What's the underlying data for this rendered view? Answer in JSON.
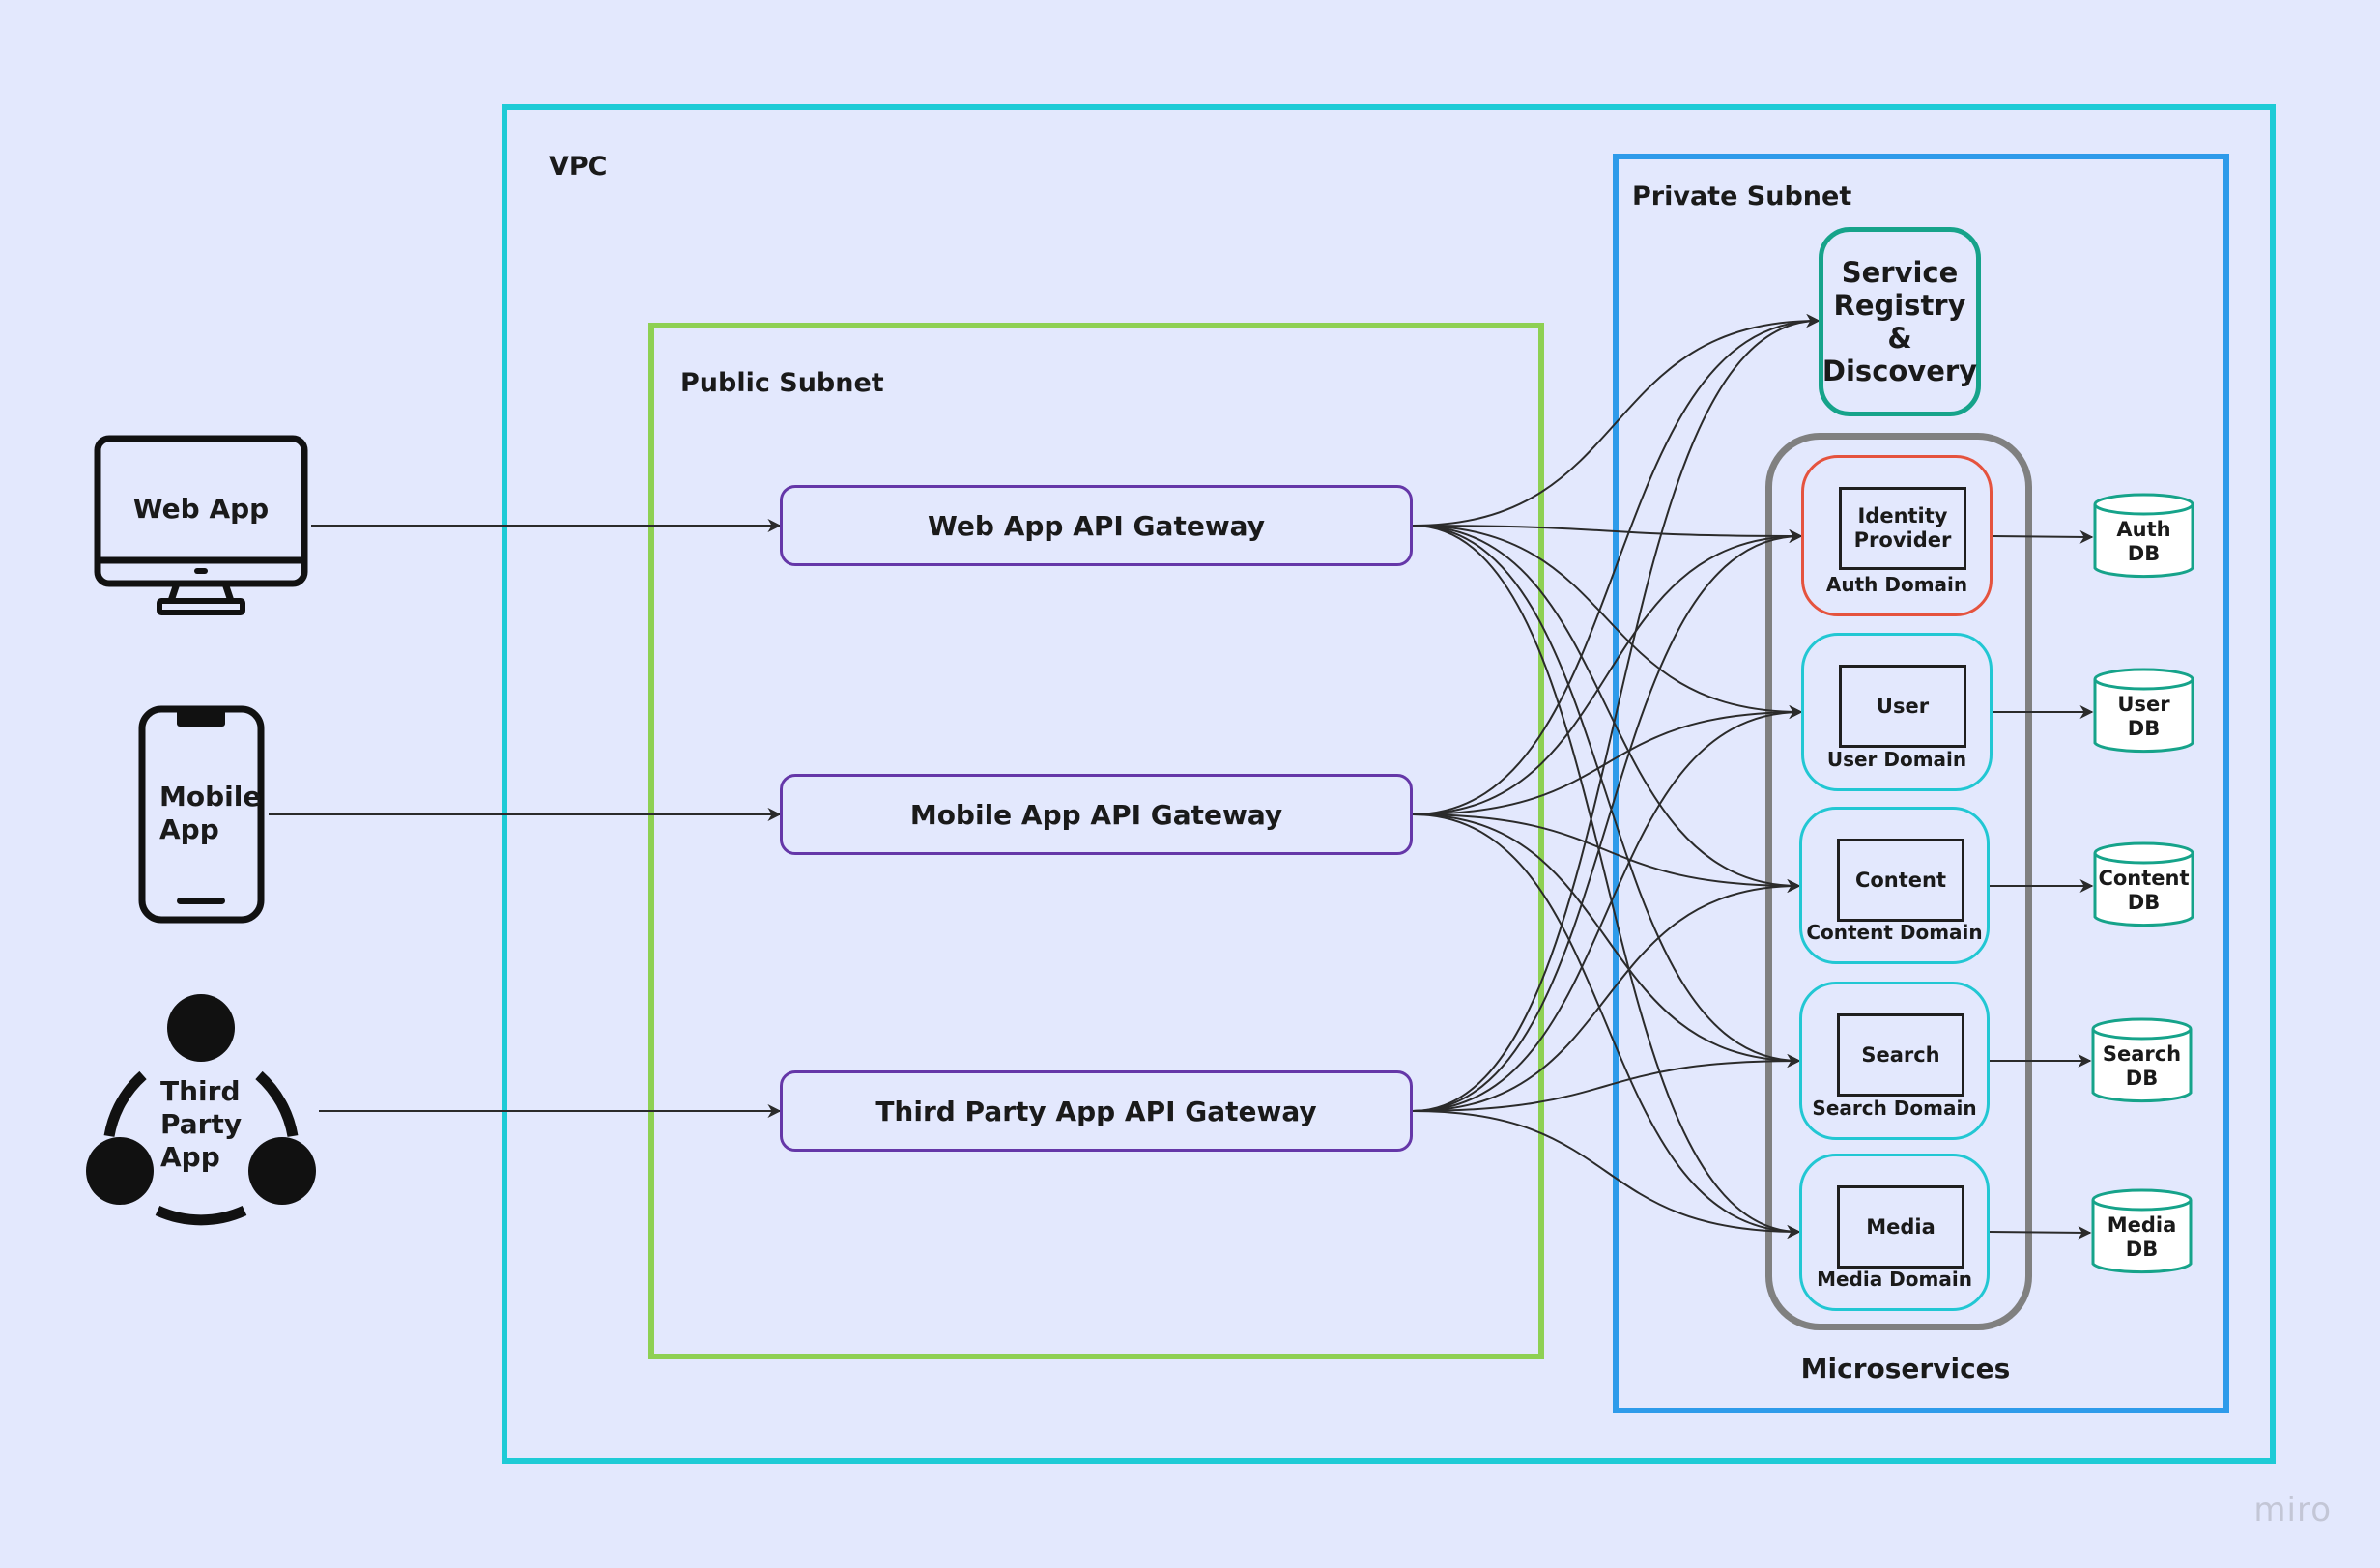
{
  "zones": {
    "vpc": "VPC",
    "public_subnet": "Public Subnet",
    "private_subnet": "Private Subnet",
    "microservices": "Microservices"
  },
  "clients": [
    {
      "id": "web",
      "label": "Web App",
      "icon": "desktop-monitor-icon"
    },
    {
      "id": "mobile",
      "label": "Mobile App",
      "icon": "smartphone-icon"
    },
    {
      "id": "third",
      "label": "Third Party App",
      "icon": "network-nodes-icon"
    }
  ],
  "gateways": [
    {
      "id": "web",
      "label": "Web App API Gateway"
    },
    {
      "id": "mobile",
      "label": "Mobile App API Gateway"
    },
    {
      "id": "third",
      "label": "Third Party App API Gateway"
    }
  ],
  "registry": {
    "label": "Service Registry & Discovery"
  },
  "domains": [
    {
      "id": "auth",
      "service": "Identity Provider",
      "domain": "Auth Domain",
      "db": "Auth DB",
      "accent": "#E5533E"
    },
    {
      "id": "user",
      "service": "User",
      "domain": "User Domain",
      "db": "User DB",
      "accent": "#22C7D3"
    },
    {
      "id": "content",
      "service": "Content",
      "domain": "Content Domain",
      "db": "Content DB",
      "accent": "#22C7D3"
    },
    {
      "id": "search",
      "service": "Search",
      "domain": "Search Domain",
      "db": "Search DB",
      "accent": "#22C7D3"
    },
    {
      "id": "media",
      "service": "Media",
      "domain": "Media Domain",
      "db": "Media DB",
      "accent": "#22C7D3"
    }
  ],
  "connections": {
    "client_to_gateway": [
      [
        "web",
        "web"
      ],
      [
        "mobile",
        "mobile"
      ],
      [
        "third",
        "third"
      ]
    ],
    "gateway_targets": [
      "registry",
      "auth",
      "user",
      "content",
      "search",
      "media"
    ],
    "domain_to_db": [
      "auth",
      "user",
      "content",
      "search",
      "media"
    ]
  },
  "colors": {
    "background": "#E3E8FD",
    "vpc": "#1ECBD6",
    "public_subnet": "#8ED053",
    "private_subnet": "#2E9BEA",
    "gateway": "#6537A8",
    "registry": "#16A38A",
    "microservices": "#808080",
    "db": "#16A38A",
    "connector": "#2b2b2b"
  },
  "watermark": "miro"
}
